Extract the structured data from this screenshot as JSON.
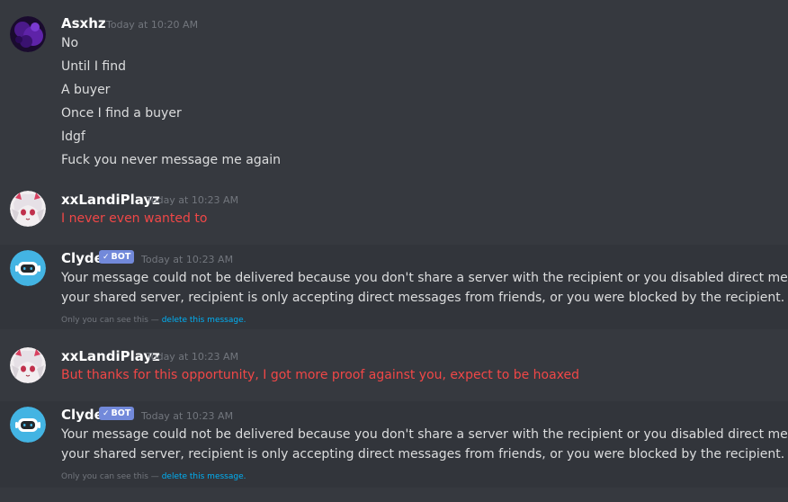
{
  "messages": [
    {
      "author": "Asxhz",
      "timestamp": "Today at 10:20 AM",
      "lines": [
        "No",
        "Until I find",
        "A buyer",
        "Once I find a buyer",
        "Idgf",
        "Fuck you never message me again"
      ]
    },
    {
      "author": "xxLandiPlayz",
      "timestamp": "Today at 10:23 AM",
      "lines": [
        "I never even wanted to"
      ],
      "text_color": "#f04747"
    },
    {
      "author": "Clyde",
      "bot_tag": "BOT",
      "timestamp": "Today at 10:23 AM",
      "lines": [
        "Your message could not be delivered because you don't share a server with the recipient or you disabled direct messages on",
        "your shared server, recipient is only accepting direct messages from friends, or you were blocked by the recipient."
      ],
      "ephemeral_note": "Only you can see this —",
      "delete_link": "delete this message."
    },
    {
      "author": "xxLandiPlayz",
      "timestamp": "Today at 10:23 AM",
      "lines": [
        "But thanks for this opportunity, I got more proof against you, expect to be hoaxed"
      ],
      "text_color": "#f04747"
    },
    {
      "author": "Clyde",
      "bot_tag": "BOT",
      "timestamp": "Today at 10:23 AM",
      "lines": [
        "Your message could not be delivered because you don't share a server with the recipient or you disabled direct messages on",
        "your shared server, recipient is only accepting direct messages from friends, or you were blocked by the recipient."
      ],
      "ephemeral_note": "Only you can see this —",
      "delete_link": "delete this message."
    }
  ],
  "colors": {
    "background": "#36393f",
    "ephemeral_background": "#32353b",
    "username": "#ffffff",
    "timestamp": "#72767d",
    "message_text": "#dcddde",
    "red_text": "#f04747",
    "bot_tag": "#7289da",
    "link": "#00b0f4"
  },
  "icons": {
    "asxhz_avatar": "purple-avatar-icon",
    "landi_avatar": "anime-girl-avatar-icon",
    "clyde_avatar": "clyde-bot-avatar-icon",
    "verified_check": "checkmark-icon"
  }
}
